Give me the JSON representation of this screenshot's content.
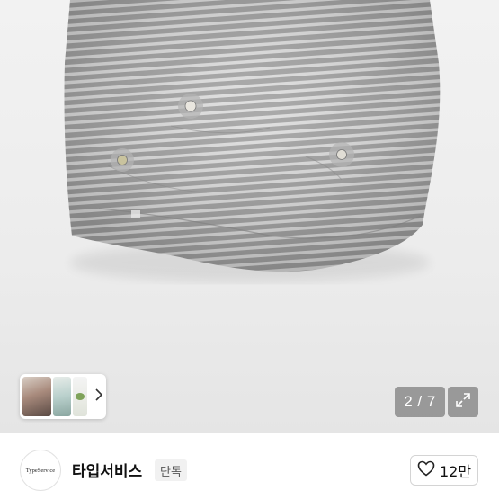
{
  "gallery": {
    "image_alt_icon": "beanie-photo",
    "counter_text": "2 / 7",
    "expand_icon": "expand-icon"
  },
  "thumbnails": {
    "next_icon": "chevron-right-icon"
  },
  "seller": {
    "avatar_text": "TypeService",
    "name": "타입서비스",
    "badge": "단독"
  },
  "like": {
    "icon": "heart-icon",
    "count": "12만"
  },
  "colors": {
    "stripe_dark": "#9a9a9a",
    "stripe_light": "#dcdcdc",
    "photo_bg": "#ececec"
  }
}
